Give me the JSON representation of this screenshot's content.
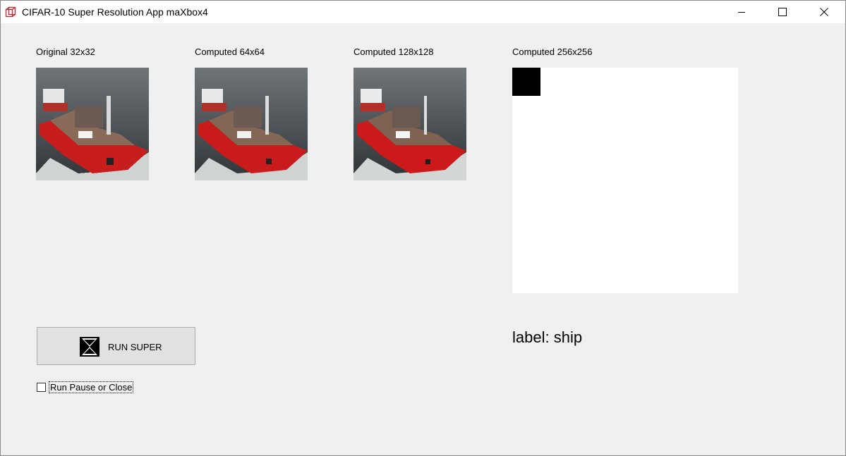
{
  "window": {
    "title": "CIFAR-10 Super Resolution App maXbox4",
    "app_icon": "maxbox-cube-icon",
    "controls": [
      "minimize-icon",
      "maximize-icon",
      "close-icon"
    ]
  },
  "images": [
    {
      "caption": "Original 32x32",
      "content": "ship-image"
    },
    {
      "caption": "Computed 64x64",
      "content": "ship-image"
    },
    {
      "caption": "Computed 128x128",
      "content": "ship-image"
    },
    {
      "caption": "Computed 256x256",
      "content": "empty-canvas"
    }
  ],
  "result": {
    "label": "label: ship"
  },
  "run_button": {
    "label": "RUN SUPER",
    "icon": "hourglass-x-icon"
  },
  "checkbox": {
    "label": "Run Pause or Close",
    "checked": false
  },
  "colors": {
    "window_bg": "#f0f0f0",
    "titlebar_bg": "#ffffff",
    "button_bg": "#e1e1e1",
    "ship_red": "#d11a1a",
    "water_dark": "#3c4247"
  }
}
